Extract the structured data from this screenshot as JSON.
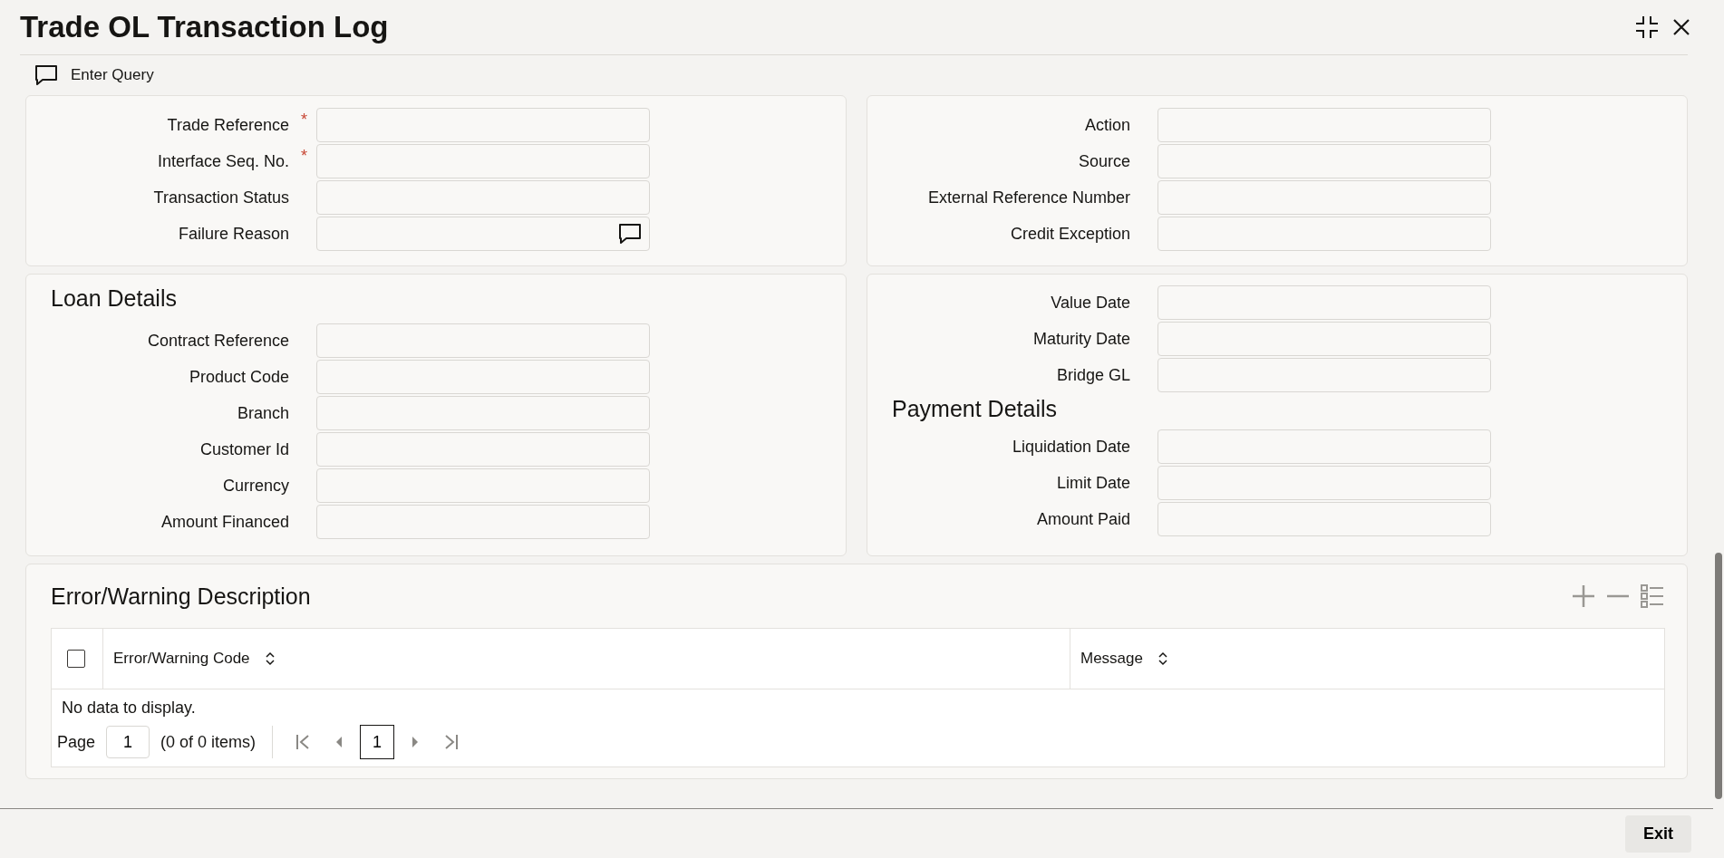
{
  "window": {
    "title": "Trade OL Transaction Log"
  },
  "toolbar": {
    "label": "Enter Query"
  },
  "main_panel": {
    "left_fields": [
      {
        "label": "Trade Reference",
        "required_mark": "*",
        "kind": "text"
      },
      {
        "label": "Interface Seq. No.",
        "required_mark": "*",
        "kind": "text"
      },
      {
        "label": "Transaction Status",
        "kind": "text"
      },
      {
        "label": "Failure Reason",
        "kind": "message"
      }
    ],
    "right_fields": [
      {
        "label": "Action",
        "kind": "text"
      },
      {
        "label": "Source",
        "kind": "text"
      },
      {
        "label": "External Reference Number",
        "kind": "text"
      },
      {
        "label": "Credit Exception",
        "kind": "text"
      }
    ]
  },
  "loan_details": {
    "title": "Loan Details",
    "fields": [
      {
        "label": "Contract Reference",
        "kind": "text"
      },
      {
        "label": "Product Code",
        "kind": "text"
      },
      {
        "label": "Branch",
        "kind": "text"
      },
      {
        "label": "Customer Id",
        "kind": "text"
      },
      {
        "label": "Currency",
        "kind": "text"
      },
      {
        "label": "Amount Financed",
        "kind": "text"
      }
    ]
  },
  "dates_panel": {
    "fields": [
      {
        "label": "Value Date",
        "kind": "text"
      },
      {
        "label": "Maturity Date",
        "kind": "text"
      },
      {
        "label": "Bridge GL",
        "kind": "text"
      }
    ],
    "payment_details": {
      "title": "Payment Details",
      "fields": [
        {
          "label": "Liquidation Date",
          "kind": "text"
        },
        {
          "label": "Limit Date",
          "kind": "text"
        },
        {
          "label": "Amount Paid",
          "kind": "text"
        }
      ]
    }
  },
  "error_section": {
    "title": "Error/Warning Description",
    "table": {
      "select_all": {
        "checked": false
      },
      "columns": [
        {
          "label": "Error/Warning Code",
          "sortable": true
        },
        {
          "label": "Message",
          "sortable": true
        }
      ],
      "empty_text": "No data to display.",
      "pagination": {
        "page_label": "Page",
        "page_value": "1",
        "summary": "(0 of 0 items)",
        "current_page": "1"
      }
    }
  },
  "footer": {
    "exit_button": "Exit"
  }
}
